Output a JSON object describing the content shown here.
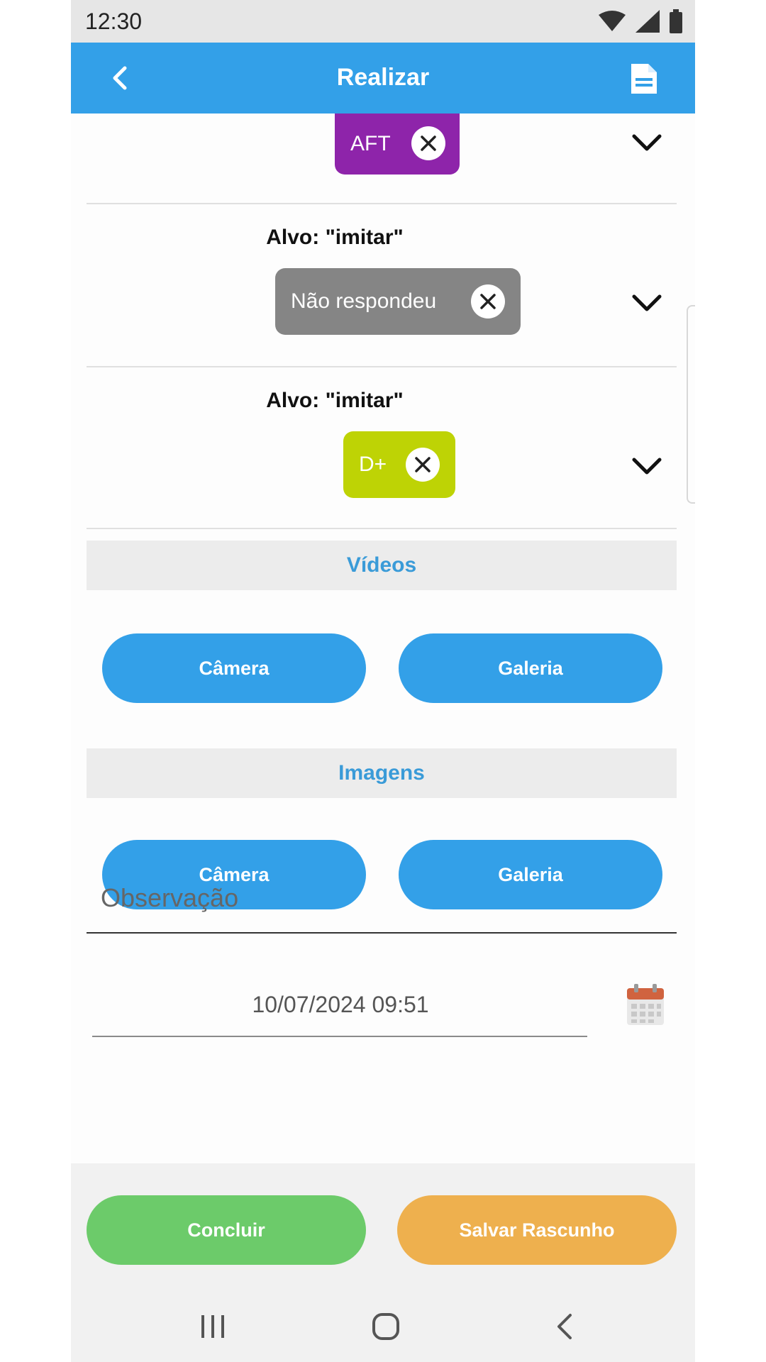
{
  "status_bar": {
    "time": "12:30"
  },
  "app_bar": {
    "title": "Realizar"
  },
  "targets": [
    {
      "label": "",
      "chip_text": "AFT",
      "chip_color": "#8e24aa"
    },
    {
      "label": "Alvo: \"imitar\"",
      "chip_text": "Não respondeu",
      "chip_color": "#858585"
    },
    {
      "label": "Alvo: \"imitar\"",
      "chip_text": "D+",
      "chip_color": "#bed305"
    }
  ],
  "videos": {
    "header": "Vídeos",
    "camera_label": "Câmera",
    "gallery_label": "Galeria"
  },
  "images": {
    "header": "Imagens",
    "camera_label": "Câmera",
    "gallery_label": "Galeria"
  },
  "observation": {
    "placeholder": "Observação"
  },
  "date_field": {
    "value": "10/07/2024 09:51"
  },
  "actions": {
    "conclude_label": "Concluir",
    "conclude_color": "#6ccb6a",
    "save_draft_label": "Salvar Rascunho",
    "save_draft_color": "#eeb04e"
  },
  "colors": {
    "primary": "#33a0e8"
  }
}
